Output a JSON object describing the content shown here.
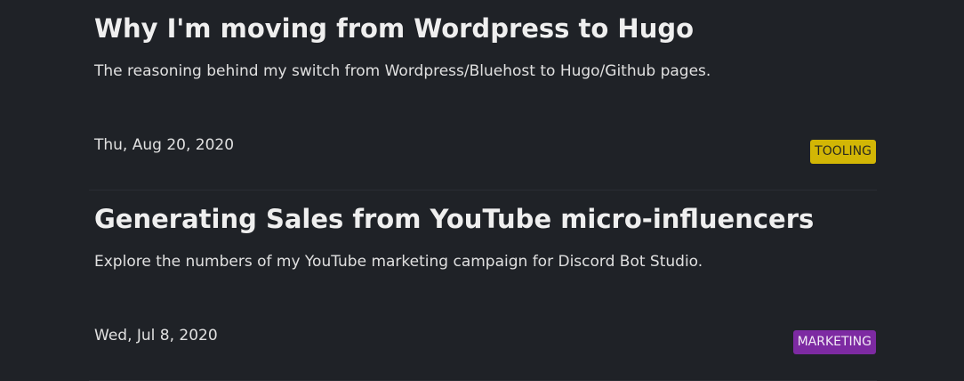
{
  "posts": [
    {
      "title": "Why I'm moving from Wordpress to Hugo",
      "description": "The reasoning behind my switch from Wordpress/Bluehost to Hugo/Github pages.",
      "date": "Thu, Aug 20, 2020",
      "tag": {
        "label": "TOOLING",
        "color": "#d2b605"
      }
    },
    {
      "title": "Generating Sales from YouTube micro-influencers",
      "description": "Explore the numbers of my YouTube marketing campaign for Discord Bot Studio.",
      "date": "Wed, Jul 8, 2020",
      "tag": {
        "label": "MARKETING",
        "color": "#7d2aa2"
      }
    }
  ]
}
